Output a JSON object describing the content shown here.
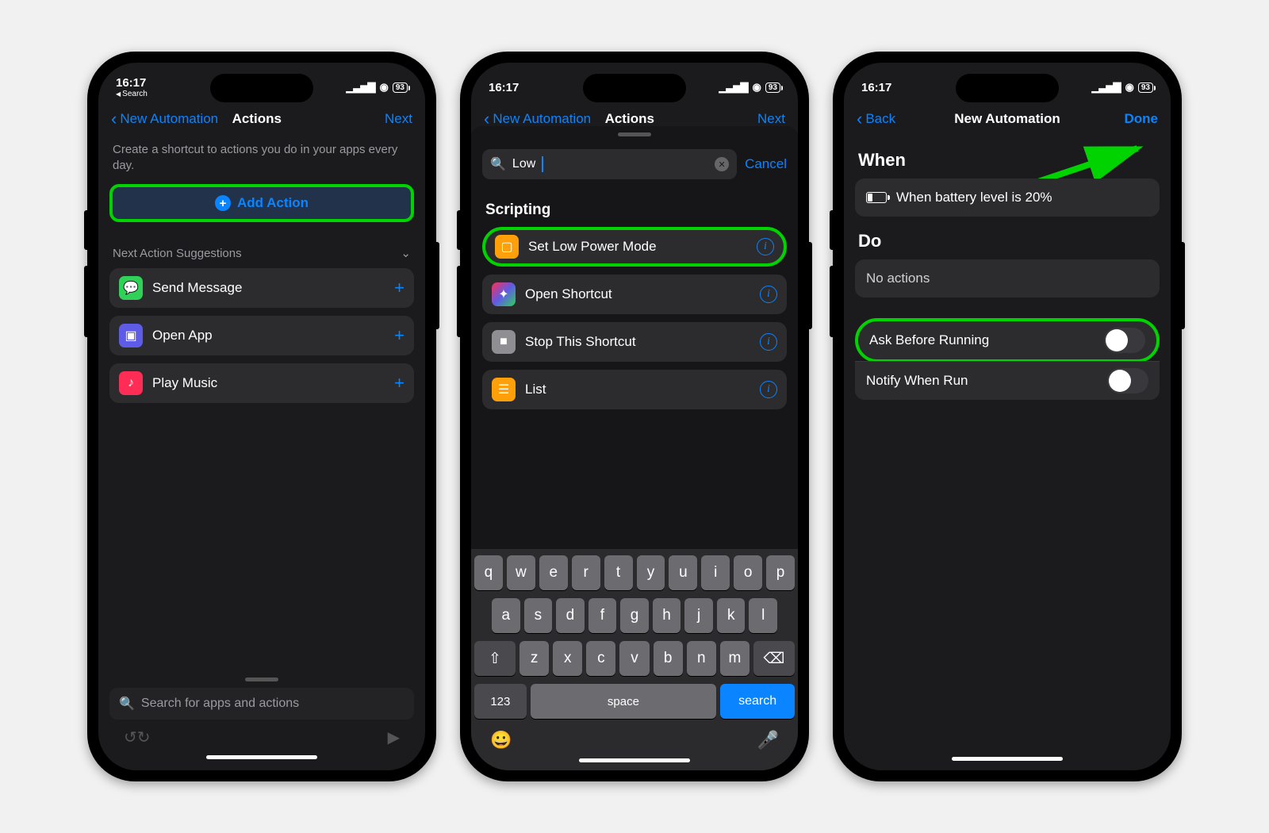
{
  "status": {
    "time": "16:17",
    "battery": "93",
    "back_to": "Search"
  },
  "phone1": {
    "nav_back": "New Automation",
    "nav_title": "Actions",
    "nav_right": "Next",
    "helper": "Create a shortcut to actions you do in your apps every day.",
    "add_action": "Add Action",
    "suggest_header": "Next Action Suggestions",
    "suggestions": [
      {
        "label": "Send Message",
        "icon_bg": "#30d158",
        "glyph": "💬"
      },
      {
        "label": "Open App",
        "icon_bg": "#5e5ce6",
        "glyph": "▣"
      },
      {
        "label": "Play Music",
        "icon_bg": "#ff2d55",
        "glyph": "♪"
      }
    ],
    "search_placeholder": "Search for apps and actions"
  },
  "phone2": {
    "nav_back": "New Automation",
    "nav_title": "Actions",
    "nav_right": "Next",
    "search_value": "Low",
    "cancel": "Cancel",
    "section": "Scripting",
    "results": [
      {
        "label": "Set Low Power Mode",
        "icon_bg": "#ff9f0a",
        "glyph": "▢",
        "hl": true
      },
      {
        "label": "Open Shortcut",
        "icon_bg": "#000",
        "glyph": "✦",
        "grad": true
      },
      {
        "label": "Stop This Shortcut",
        "icon_bg": "#8e8e93",
        "glyph": "■"
      },
      {
        "label": "List",
        "icon_bg": "#ff9f0a",
        "glyph": "☰"
      }
    ],
    "keys_r1": [
      "q",
      "w",
      "e",
      "r",
      "t",
      "y",
      "u",
      "i",
      "o",
      "p"
    ],
    "keys_r2": [
      "a",
      "s",
      "d",
      "f",
      "g",
      "h",
      "j",
      "k",
      "l"
    ],
    "keys_r3": [
      "z",
      "x",
      "c",
      "v",
      "b",
      "n",
      "m"
    ],
    "key_123": "123",
    "key_space": "space",
    "key_search": "search"
  },
  "phone3": {
    "nav_back": "Back",
    "nav_title": "New Automation",
    "nav_right": "Done",
    "when": "When",
    "when_text": "When battery level is 20%",
    "do": "Do",
    "do_text": "No actions",
    "opt1": "Ask Before Running",
    "opt2": "Notify When Run"
  }
}
